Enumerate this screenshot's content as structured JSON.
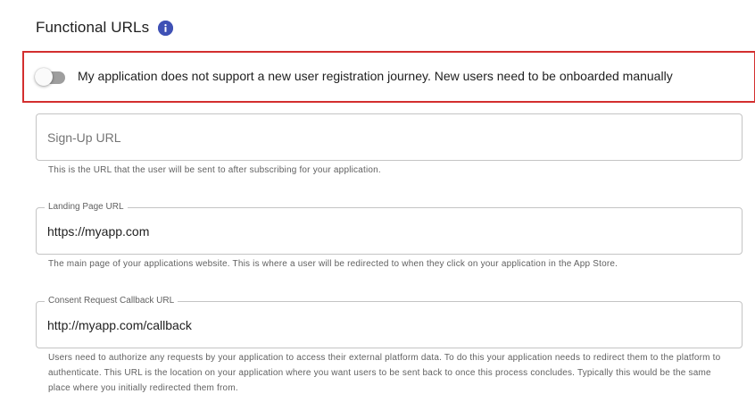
{
  "section": {
    "title": "Functional URLs",
    "info_icon": "info-icon"
  },
  "registration_toggle": {
    "label": "My application does not support a new user registration journey. New users need to be onboarded manually",
    "enabled": false,
    "highlight_color": "#d32f2f"
  },
  "fields": {
    "signup": {
      "label": "Sign-Up URL",
      "placeholder": "Sign-Up URL",
      "value": "",
      "helper": "This is the URL that the user will be sent to after subscribing for your application."
    },
    "landing": {
      "label": "Landing Page URL",
      "value": "https://myapp.com",
      "helper": "The main page of your applications website. This is where a user will be redirected to when they click on your application in the App Store."
    },
    "consent_callback": {
      "label": "Consent Request Callback URL",
      "value": "http://myapp.com/callback",
      "helper": "Users need to authorize any requests by your application to access their external platform data. To do this your application needs to redirect them to the platform to authenticate. This URL is the location on your application where you want users to be sent back to once this process concludes. Typically this would be the same place where you initially redirected them from."
    }
  },
  "colors": {
    "accent": "#3f51b5",
    "toggle_off_track": "#9e9e9e",
    "field_border": "#c4c4c4"
  }
}
